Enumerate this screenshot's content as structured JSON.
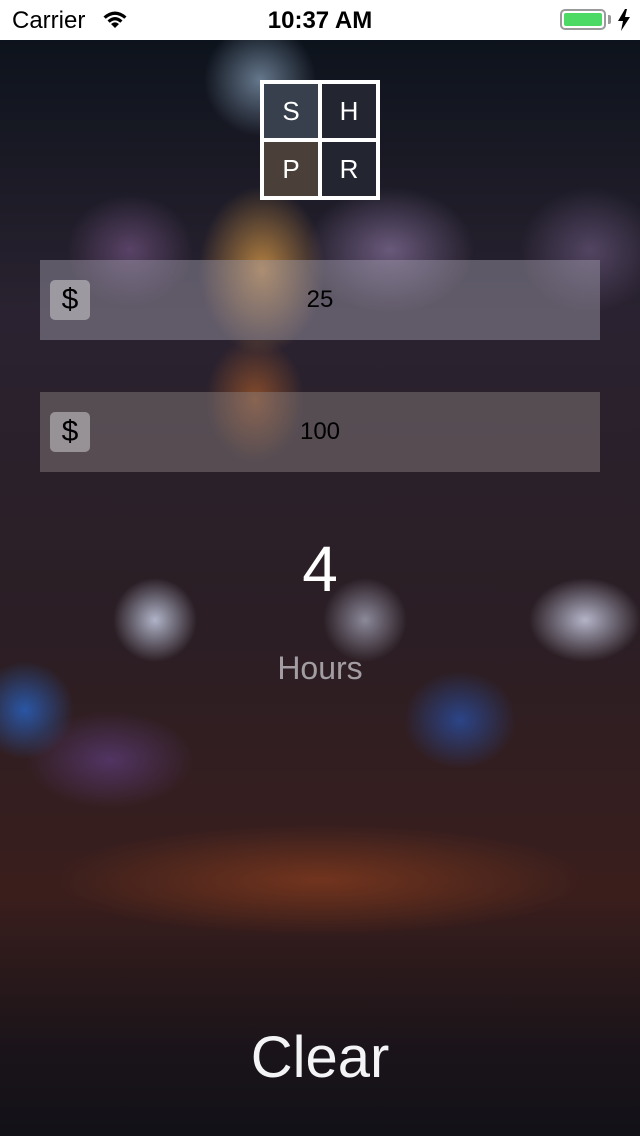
{
  "status_bar": {
    "carrier": "Carrier",
    "time": "10:37 AM",
    "battery_color": "#4cd964"
  },
  "logo": {
    "letters": [
      "S",
      "H",
      "P",
      "R"
    ]
  },
  "inputs": [
    {
      "currency_icon": "$",
      "value": "25"
    },
    {
      "currency_icon": "$",
      "value": "100"
    }
  ],
  "result": {
    "value": "4",
    "unit": "Hours"
  },
  "actions": {
    "clear_label": "Clear"
  }
}
